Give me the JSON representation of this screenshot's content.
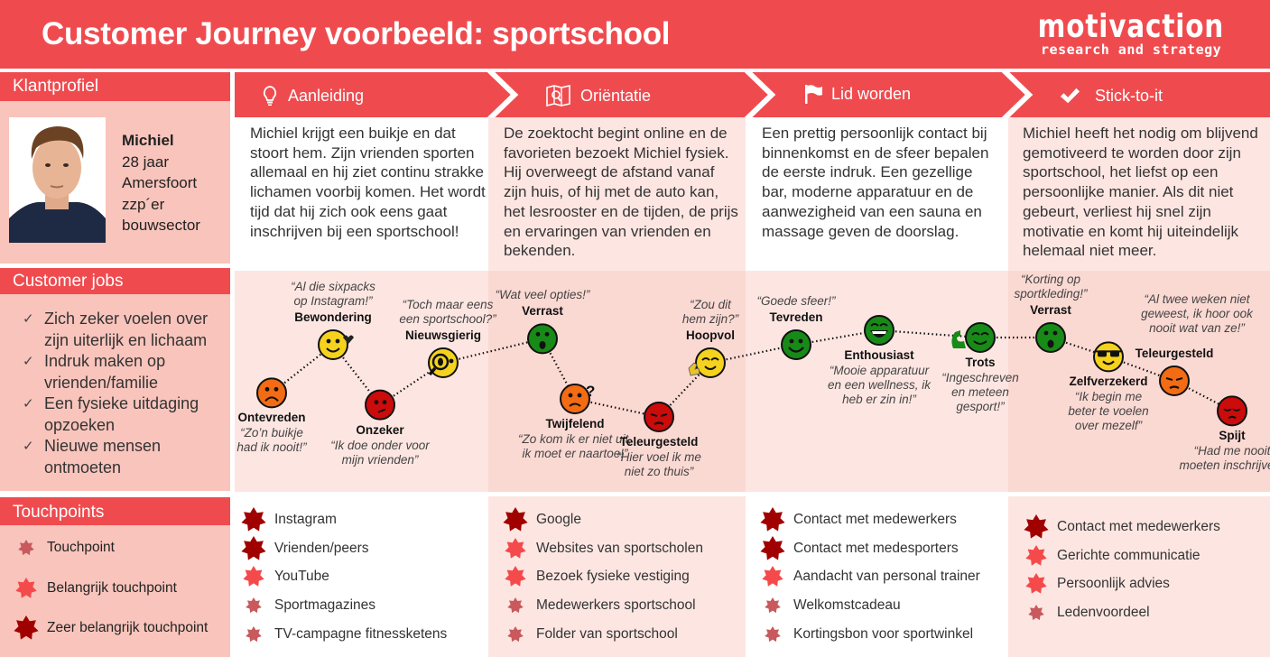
{
  "header": {
    "title": "Customer Journey voorbeeld: sportschool",
    "logo_main": "motivaction",
    "logo_sub": "research and strategy"
  },
  "colors": {
    "brand_red": "#ef4b4f",
    "left_panel": "#f8c4bb",
    "col_pink": "#fde6e2",
    "touchpoint": "#c85a5e",
    "touchpoint_important": "#f44a4c",
    "touchpoint_very_important": "#a00000"
  },
  "sidebar": {
    "profile": {
      "heading": "Klantprofiel",
      "name": "Michiel",
      "details": [
        "28 jaar",
        "Amersfoort",
        "zzp´er",
        "bouwsector"
      ]
    },
    "jobs": {
      "heading": "Customer jobs",
      "items": [
        "Zich zeker voelen over zijn uiterlijk en lichaam",
        "Indruk maken op vrienden/familie",
        "Een fysieke uitdaging opzoeken",
        "Nieuwe mensen ontmoeten"
      ]
    },
    "touchpoints": {
      "heading": "Touchpoints",
      "legend": [
        {
          "label": "Touchpoint",
          "level": 1
        },
        {
          "label": "Belangrijk touchpoint",
          "level": 2
        },
        {
          "label": "Zeer belangrijk touchpoint",
          "level": 3
        }
      ]
    }
  },
  "phases": [
    {
      "label": "Aanleiding",
      "icon": "lightbulb-icon",
      "description": "Michiel krijgt een buikje en dat stoort hem. Zijn vrienden sporten allemaal en hij ziet continu strakke lichamen voorbij komen. Het wordt tijd dat hij zich ook eens gaat inschrijven bij een sportschool!",
      "touchpoints": [
        {
          "label": "Instagram",
          "level": 3
        },
        {
          "label": "Vrienden/peers",
          "level": 3
        },
        {
          "label": "YouTube",
          "level": 2
        },
        {
          "label": "Sportmagazines",
          "level": 1
        },
        {
          "label": "TV-campagne fitnessketens",
          "level": 1
        }
      ]
    },
    {
      "label": "Oriëntatie",
      "icon": "map-search-icon",
      "description": "De zoektocht begint online en de favorieten bezoekt Michiel fysiek. Hij overweegt de afstand vanaf zijn huis, of hij met de auto kan, het lesrooster en de tijden, de prijs en ervaringen van vrienden en bekenden.",
      "touchpoints": [
        {
          "label": "Google",
          "level": 3
        },
        {
          "label": "Websites van sportscholen",
          "level": 2
        },
        {
          "label": "Bezoek fysieke vestiging",
          "level": 2
        },
        {
          "label": "Medewerkers sportschool",
          "level": 1
        },
        {
          "label": "Folder van sportschool",
          "level": 1
        }
      ]
    },
    {
      "label": "Lid worden",
      "icon": "flag-icon",
      "description": "Een prettig persoonlijk contact bij binnenkomst en de sfeer bepalen de eerste indruk. Een gezellige bar, moderne apparatuur en de aanwezigheid van een sauna en massage geven de doorslag.",
      "touchpoints": [
        {
          "label": "Contact met medewerkers",
          "level": 3
        },
        {
          "label": "Contact met medesporters",
          "level": 3
        },
        {
          "label": "Aandacht van personal trainer",
          "level": 2
        },
        {
          "label": "Welkomstcadeau",
          "level": 1
        },
        {
          "label": "Kortingsbon voor sportwinkel",
          "level": 1
        }
      ]
    },
    {
      "label": "Stick-to-it",
      "icon": "checkmark-icon",
      "description": "Michiel heeft het nodig om blijvend gemotiveerd te worden door zijn sportschool, het liefst op een persoonlijke manier. Als dit niet gebeurt, verliest hij snel zijn motivatie en komt hij uiteindelijk helemaal niet meer.",
      "touchpoints": [
        {
          "label": "Contact met medewerkers",
          "level": 3
        },
        {
          "label": "Gerichte communicatie",
          "level": 2
        },
        {
          "label": "Persoonlijk advies",
          "level": 2
        },
        {
          "label": "Ledenvoordeel",
          "level": 1
        }
      ]
    }
  ],
  "emotions": [
    {
      "name": "Ontevreden",
      "quote": "“Zo’n buikje\nhad ik nooit!”",
      "color": "#f36b13",
      "face": "sad",
      "mood": 0.3
    },
    {
      "name": "Bewondering",
      "quote": "“Al die sixpacks\nop Instagram!”",
      "color": "#f5d21d",
      "face": "love",
      "mood": 0.7
    },
    {
      "name": "Onzeker",
      "quote": "“Ik doe onder voor\nmijn vrienden”",
      "color": "#cc0b0b",
      "face": "unsure",
      "mood": 0.2
    },
    {
      "name": "Nieuwsgierig",
      "quote": "“Toch maar eens\neen sportschool?”",
      "color": "#f5d21d",
      "face": "curious",
      "mood": 0.55
    },
    {
      "name": "Verrast",
      "quote": "“Wat veel opties!”",
      "color": "#178a17",
      "face": "surprised",
      "mood": 0.75
    },
    {
      "name": "Twijfelend",
      "quote": "“Zo kom ik er niet uit,\nik moet er naartoe!”",
      "color": "#f36b13",
      "face": "doubt",
      "mood": 0.25
    },
    {
      "name": "Teleurgesteld",
      "quote": "“Hier voel ik me\nniet zo thuis”",
      "color": "#cc0b0b",
      "face": "disappointed",
      "mood": 0.1
    },
    {
      "name": "Hoopvol",
      "quote": "“Zou dit\nhem zijn?”",
      "color": "#f5d21d",
      "face": "hopeful",
      "mood": 0.55
    },
    {
      "name": "Tevreden",
      "quote": "“Goede sfeer!”",
      "color": "#178a17",
      "face": "happy",
      "mood": 0.7
    },
    {
      "name": "Enthousiast",
      "quote": "“Mooie apparatuur\nen een wellness, ik\nheb er zin in!”",
      "color": "#178a17",
      "face": "laugh",
      "mood": 0.82
    },
    {
      "name": "Trots",
      "quote": "“Ingeschreven\nen meteen\ngesport!”",
      "color": "#178a17",
      "face": "proud",
      "mood": 0.76
    },
    {
      "name": "Verrast",
      "quote": "“Korting op\nsportkleding!”",
      "color": "#178a17",
      "face": "surprised",
      "mood": 0.76
    },
    {
      "name": "Zelfverzekerd",
      "quote": "“Ik begin me\nbeter te voelen\nover mezelf”",
      "color": "#f5d21d",
      "face": "cool",
      "mood": 0.6
    },
    {
      "name": "Teleurgesteld",
      "quote": "“Al twee weken niet\ngeweest, ik hoor ook\nnooit wat van ze!”",
      "color": "#f36b13",
      "face": "disappointed",
      "mood": 0.4
    },
    {
      "name": "Spijt",
      "quote": "“Had me nooit\nmoeten inschrijven”",
      "color": "#cc0b0b",
      "face": "regret",
      "mood": 0.15
    }
  ]
}
